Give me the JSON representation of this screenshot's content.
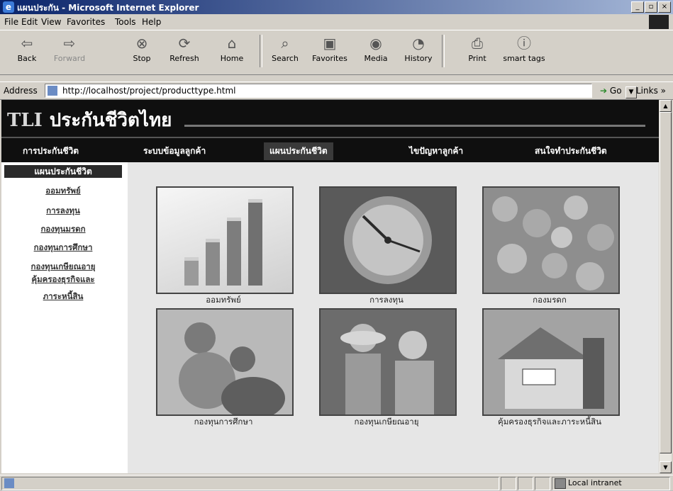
{
  "window": {
    "title": "แผนประกัน - Microsoft Internet Explorer",
    "controls": [
      "_",
      "▫",
      "×"
    ]
  },
  "menu": [
    "File",
    "Edit",
    "View",
    "Favorites",
    "Tools",
    "Help"
  ],
  "toolbar": {
    "back": "Back",
    "forward": "Forward",
    "stop": "Stop",
    "refresh": "Refresh",
    "home": "Home",
    "search": "Search",
    "favorites": "Favorites",
    "media": "Media",
    "history": "History",
    "print": "Print",
    "smarttags": "smart tags"
  },
  "address": {
    "label": "Address",
    "url": "http://localhost/project/producttype.html",
    "go": "Go",
    "links": "Links »"
  },
  "site": {
    "brand": "TLI",
    "name": "ประกันชีวิตไทย",
    "nav": [
      "การประกันชีวิต",
      "ระบบข้อมูลลูกค้า",
      "แผนประกันชีวิต",
      "ไขปัญหาลูกค้า",
      "สนใจทำประกันชีวิต"
    ]
  },
  "sidebar": {
    "heading": "แผนประกันชีวิต",
    "items": [
      "ออมทรัพย์",
      "การลงทุน",
      "กองทุนมรดก",
      "กองทุนการศึกษา",
      "กองทุนเกษียณอายุ",
      "คุ้มครองธุรกิจและ",
      "ภาระหนี้สิน"
    ]
  },
  "products": [
    {
      "caption": "ออมทรัพย์",
      "icon": "savings-coin-stacks-image"
    },
    {
      "caption": "การลงทุน",
      "icon": "investment-clock-image"
    },
    {
      "caption": "กองมรดก",
      "icon": "inheritance-coins-image"
    },
    {
      "caption": "กองทุนการศึกษา",
      "icon": "education-mother-child-image"
    },
    {
      "caption": "กองทุนเกษียณอายุ",
      "icon": "retirement-couple-image"
    },
    {
      "caption": "คุ้มครองธุรกิจและภาระหนี้สิน",
      "icon": "business-house-sold-image"
    }
  ],
  "status": {
    "zone": "Local intranet"
  },
  "colors": {
    "titlebar": "#0a246a",
    "banner": "#0f0f0f",
    "main_bg": "#e6e6e6"
  }
}
